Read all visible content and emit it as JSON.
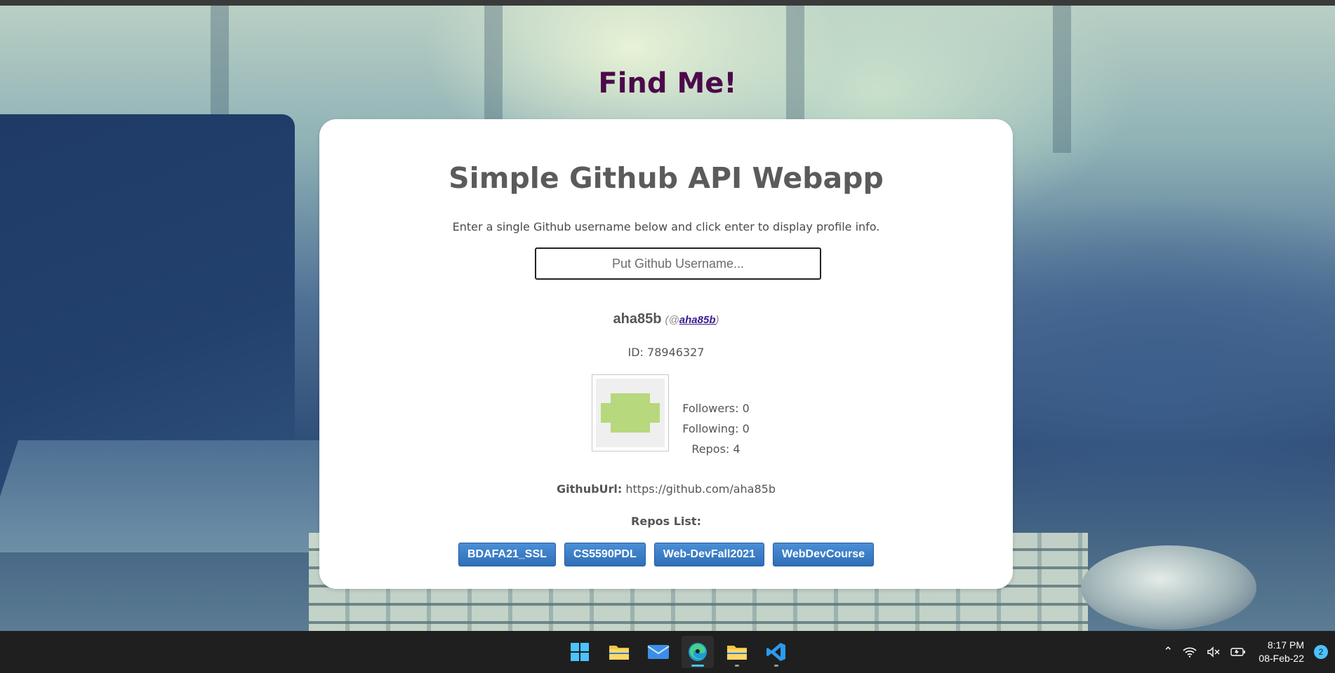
{
  "page": {
    "heading": "Find Me!"
  },
  "card": {
    "title": "Simple Github API Webapp",
    "instructions": "Enter a single Github username below and click enter to display profile info.",
    "search_placeholder": "Put Github Username...",
    "search_value": ""
  },
  "profile": {
    "name": "aha85b",
    "handle_prefix": "(@",
    "handle": "aha85b",
    "handle_suffix": ")",
    "id_text": "ID: 78946327",
    "followers_text": "Followers: 0",
    "following_text": "Following: 0",
    "repos_text": "Repos: 4",
    "url_label": "GithubUrl:",
    "url": "https://github.com/aha85b"
  },
  "repos": {
    "heading": "Repos List:",
    "items": [
      "BDAFA21_SSL",
      "CS5590PDL",
      "Web-DevFall2021",
      "WebDevCourse"
    ]
  },
  "taskbar": {
    "apps": [
      "windows-start",
      "file-explorer",
      "mail",
      "edge",
      "file-explorer-2",
      "vscode"
    ],
    "active_app": "edge",
    "clock_time": "8:17 PM",
    "clock_date": "08-Feb-22",
    "notification_count": "2"
  },
  "colors": {
    "heading": "#4b0a4a",
    "button": "#2f6fb8",
    "avatar_fill": "#b7d87d"
  }
}
